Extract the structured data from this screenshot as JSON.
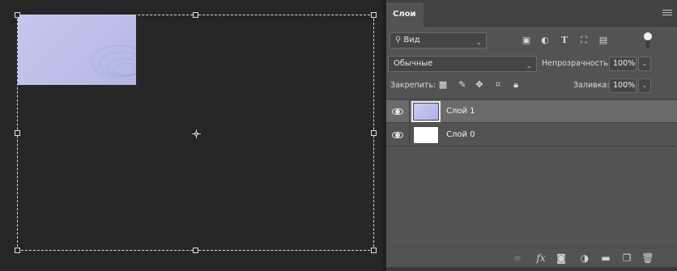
{
  "layers_panel": {
    "tab_label": "Слои",
    "filter": {
      "label": "Вид",
      "icons": [
        "image-filter-icon",
        "adjustment-filter-icon",
        "text-filter-icon",
        "shape-filter-icon",
        "smart-object-filter-icon"
      ]
    },
    "blend_mode": "Обычные",
    "opacity_label": "Непрозрачность:",
    "opacity_value": "100%",
    "lock_label": "Закрепить:",
    "fill_label": "Заливка:",
    "fill_value": "100%",
    "layers": [
      {
        "name": "Слой 1",
        "active": true,
        "visible": true
      },
      {
        "name": "Слой 0",
        "active": false,
        "visible": true
      }
    ],
    "bottom_icons": [
      "link-layers-icon",
      "fx-icon",
      "add-mask-icon",
      "adjustment-layer-icon",
      "new-group-icon",
      "new-layer-icon",
      "delete-icon"
    ]
  },
  "colors": {
    "canvas_bg": "#262626",
    "panel_bg": "#535353",
    "active_layer": "#6a6a6a",
    "image_tint": "#c0c4ec"
  }
}
